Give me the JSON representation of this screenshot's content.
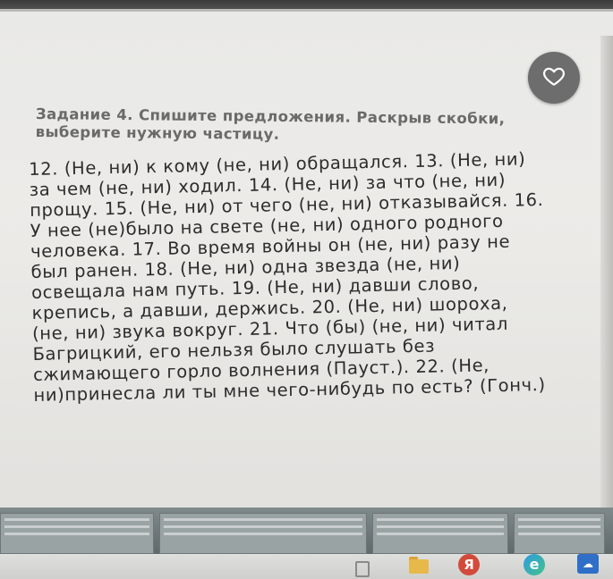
{
  "task": {
    "heading": "Задание 4. Спишите предложения. Раскрыв скобки, выберите нужную частицу.",
    "text": "12. (Не, ни) к кому (не, ни) обращался. 13. (Не, ни)\nза чем (не, ни) ходил. 14. (Не, ни) за что (не, ни)\nпрощу. 15. (Не, ни) от чего (не, ни) отказывайся. 16.\nУ нее (не)было на свете (не, ни) одного родного\nчеловека. 17. Во время войны он (не, ни) разу не\nбыл ранен. 18. (Не, ни) одна звезда (не, ни)\nосвещала нам путь. 19. (Не, ни) давши слово,\nкрепись, а давши, держись. 20. (Не, ни) шороха,\n(не, ни) звука вокруг. 21. Что (бы) (не, ни) читал\nБагрицкий, его нельзя было слушать без\nсжимающего горло волнения (Пауст.). 22. (Не,\nни)принесла ли ты мне чего-нибудь по есть? (Гонч.)"
  },
  "overlay": {
    "like_icon": "heart-icon"
  },
  "taskbar": {
    "icons": [
      "file-explorer-icon",
      "yandex-browser-icon",
      "edge-browser-icon",
      "app-icon"
    ],
    "yandex_letter": "Я"
  }
}
